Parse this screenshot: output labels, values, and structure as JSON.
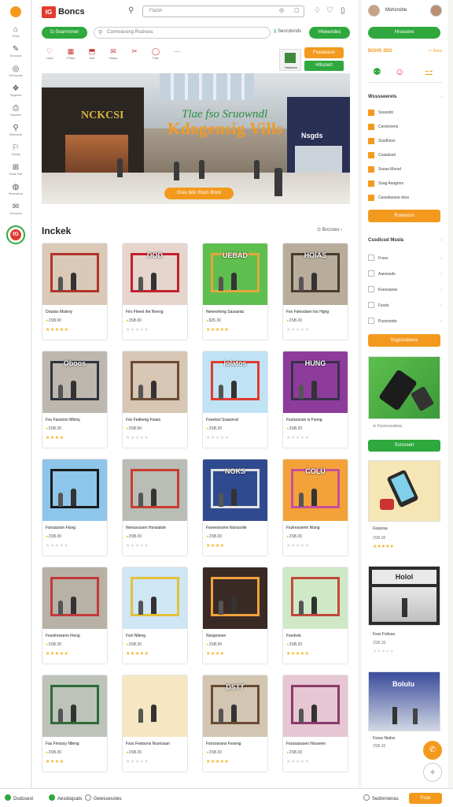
{
  "brand": {
    "mark": "IG",
    "name": "Boncs"
  },
  "top": {
    "search_placeholder": "Flatsh",
    "btn_left": "G-Searrmmer",
    "search2_placeholder": "Cormsiorsng Rsshess",
    "filter_label": "Sencdonds",
    "btn_right": "Hleeendes"
  },
  "rail": {
    "items": [
      {
        "icon": "⌂",
        "label": "Hoes"
      },
      {
        "icon": "✎",
        "label": "Srooons"
      },
      {
        "icon": "◎",
        "label": "Dersoods"
      },
      {
        "icon": "❖",
        "label": "Ssgeers"
      },
      {
        "icon": "⎙",
        "label": "Bopees"
      },
      {
        "icon": "⚲",
        "label": "Beeceds"
      },
      {
        "icon": "⚐",
        "label": "Ssnsly"
      },
      {
        "icon": "⊞",
        "label": "Hsds Fae"
      },
      {
        "icon": "◍",
        "label": "Resrsless"
      },
      {
        "icon": "✉",
        "label": "Deroons"
      }
    ],
    "badge": "IG"
  },
  "icon_row": [
    {
      "icon": "♡",
      "label": "Loes"
    },
    {
      "icon": "▦",
      "label": "F'Nss"
    },
    {
      "icon": "⬒",
      "label": "Dsn"
    },
    {
      "icon": "✉",
      "label": "Hrsos"
    },
    {
      "icon": "✂",
      "label": ""
    },
    {
      "icon": "◯",
      "label": "Fsle"
    },
    {
      "icon": "⋯",
      "label": ""
    }
  ],
  "logo_tile": {
    "caption": "Haasane"
  },
  "promo": {
    "btn1": "Fseatoesh",
    "btn2": "Hllsstert"
  },
  "hero": {
    "store_left": "NCKCSI",
    "store_right": "Nsgds",
    "title1": "Tlae fso Sruowndl",
    "title2": "Kdogensig Vills",
    "cta": "Gsre brkr Rsnn Bmst"
  },
  "section": {
    "title": "Inckek",
    "more": "Brccnes"
  },
  "products": [
    {
      "name": "Draslss Msteriy",
      "price": "2SB.90",
      "rating": 5,
      "sign": "",
      "bg": "#d9c9b6",
      "frame": "#b2342c"
    },
    {
      "name": "Firs Fleenl ihe Nneng",
      "price": "3SB.90",
      "rating": 0,
      "sign": "DOD",
      "bg": "#e5d5cc",
      "frame": "#c4202f"
    },
    {
      "name": "Neeeerkmg Sassanta",
      "price": "$35.30",
      "rating": 5,
      "sign": "UEBAD",
      "bg": "#5fbf4e",
      "frame": "#e2a63c"
    },
    {
      "name": "Fsn Fsleodsen fso Hgng",
      "price": "2SB.30",
      "rating": 0,
      "sign": "HOIAS",
      "bg": "#b8ad9a",
      "frame": "#4a3c2e"
    },
    {
      "name": "Fss Fasonon Mbmy",
      "price": "2SB.30",
      "rating": 4,
      "sign": "Oboos",
      "bg": "#bdb7ad",
      "frame": "#2e3340"
    },
    {
      "name": "Fse Fedkeng Fsaes",
      "price": "2SB.90",
      "rating": 0,
      "sign": "",
      "bg": "#d7c6b3",
      "frame": "#6b4b34"
    },
    {
      "name": "Fseetssl Ssaoonal",
      "price": "2SB.30",
      "rating": 0,
      "sign": "lolatos",
      "bg": "#bfe3f5",
      "frame": "#e23b2e"
    },
    {
      "name": "Fsulsssnon is Fsong",
      "price": "2SB.30",
      "rating": 0,
      "sign": "HUNG",
      "bg": "#8e3c9c",
      "frame": "#3a2f4c"
    },
    {
      "name": "Fsnsasson Ftsng",
      "price": "2SB.30",
      "rating": 0,
      "sign": "",
      "bg": "#8ec5ea",
      "frame": "#1a1a1a"
    },
    {
      "name": "Nenssossen Hsnsalste",
      "price": "2SB.30",
      "rating": 0,
      "sign": "",
      "bg": "#b9bdb6",
      "frame": "#c93c32"
    },
    {
      "name": "Fseeesnsme Nsnssolle",
      "price": "2SB.30",
      "rating": 4,
      "sign": "NOKS",
      "bg": "#2f4a8f",
      "frame": "#e2e2e2"
    },
    {
      "name": "Fsslressemn Nlsng",
      "price": "2SB.30",
      "rating": 0,
      "sign": "COLU",
      "bg": "#f3a23a",
      "frame": "#c64f9d"
    },
    {
      "name": "Fesolressens Fleng",
      "price": "2SB.30",
      "rating": 5,
      "sign": "",
      "bg": "#b8b1a6",
      "frame": "#c43a3a"
    },
    {
      "name": "Fsnl Nlleng",
      "price": "2SB.30",
      "rating": 5,
      "sign": "",
      "bg": "#cfe6f4",
      "frame": "#e3c23a"
    },
    {
      "name": "Nsegonsen",
      "price": "2SB.90",
      "rating": 4,
      "sign": "",
      "bg": "#3a2a26",
      "frame": "#f1a23a"
    },
    {
      "name": "Fsedsok",
      "price": "2SB.30",
      "rating": 5,
      "sign": "",
      "bg": "#cfe9c7",
      "frame": "#c24a3a"
    },
    {
      "name": "Fas Fmsssy Nlleng",
      "price": "2SB.30",
      "rating": 4,
      "sign": "",
      "bg": "#bdc3b8",
      "frame": "#2e6b3a"
    },
    {
      "name": "Fsss Festsons Nsonssan",
      "price": "2SB.30",
      "rating": 0,
      "sign": "",
      "bg": "#f6e7c2",
      "frame": "#f6e7c2"
    },
    {
      "name": "Fsnsosssns Fsoeng",
      "price": "2SB.30",
      "rating": 5,
      "sign": "DSTT",
      "bg": "#d2c6b3",
      "frame": "#6b4a34"
    },
    {
      "name": "Fssssasssen Nsoseen",
      "price": "2SB.30",
      "rating": 0,
      "sign": "",
      "bg": "#e6c6d3",
      "frame": "#8a3b6b"
    }
  ],
  "right": {
    "user_name": "Mshsnshe",
    "btn_top": "Hrsesere",
    "section1_title": "BOHS 3DS",
    "section1_action": "Ross",
    "tabs": [
      "⚉",
      "☺",
      "⚍"
    ],
    "cat_title": "Wsssseerels",
    "categories": [
      {
        "label": "Ssssodo",
        "checked": true
      },
      {
        "label": "Cersinnens",
        "checked": true
      },
      {
        "label": "Sssdhsos",
        "checked": true
      },
      {
        "label": "Csasdssd",
        "checked": true
      },
      {
        "label": "Ssosa Msrsd",
        "checked": true
      },
      {
        "label": "Ssag Asagnns",
        "checked": true
      },
      {
        "label": "Cassdassea dsss",
        "checked": true
      }
    ],
    "btn_apply": "Rsenesrs",
    "filter_title": "Cssdicsd Mssla",
    "filters": [
      "Frses",
      "Aansssds",
      "Ksessanse",
      "Fssds",
      "Pusnnstdo"
    ],
    "btn_orange2": "Ssgsssdsess",
    "img1_caption": "Fssnnsssdsso",
    "btn_green3": "Ssrsssen",
    "product1": {
      "name": "Fsssnsa",
      "price": "2SB.90"
    },
    "product2": {
      "name": "Fsss Fsdssa",
      "price": "2SB.30"
    },
    "product3": {
      "name": "Fssss Nsdss",
      "price": "2SB.30"
    },
    "product3_sign": "Bolulu",
    "product2_sign": "Holol"
  },
  "footer": {
    "item1": "Dudssest",
    "item2": "Aesdoqsats",
    "item3": "Gewssesstes",
    "item4": "Sednnnenas",
    "btn": "Fsse"
  },
  "colors": {
    "accent_green": "#2fa83e",
    "accent_orange": "#f39a1e",
    "brand_red": "#e23b2e"
  }
}
